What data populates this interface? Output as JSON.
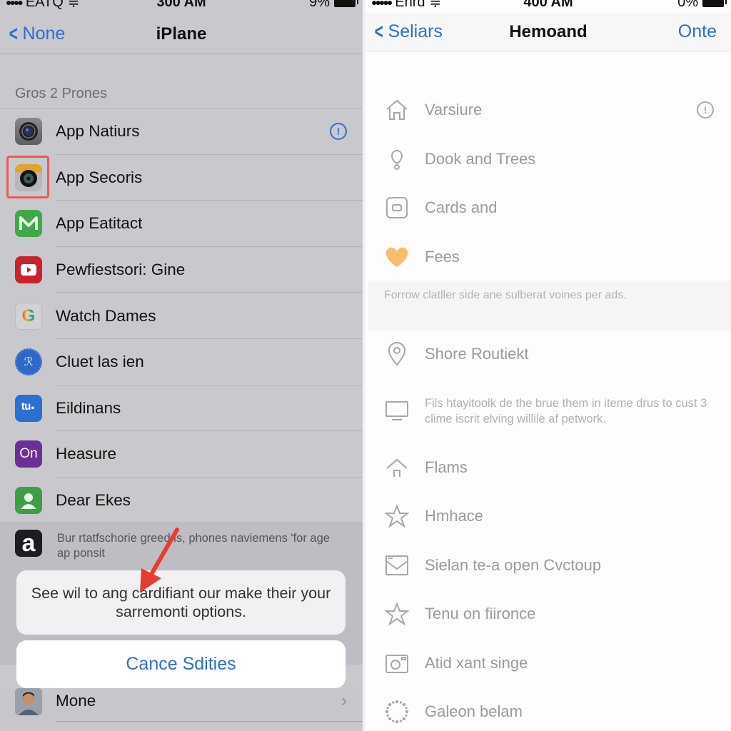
{
  "left_screen": {
    "status_bar": {
      "carrier": "EATQ",
      "time": "300 AM",
      "battery": "9%"
    },
    "nav": {
      "back_label": "None",
      "title": "iPlane"
    },
    "section_header": "Gros 2 Prones",
    "items": [
      {
        "label": "App Natiurs",
        "icon": "camera-lens-icon",
        "has_info": true
      },
      {
        "label": "App Secoris",
        "icon": "security-camera-icon",
        "highlighted": true
      },
      {
        "label": "App Eatitact",
        "icon": "mail-m-icon"
      },
      {
        "label": "Pewfiestsori: Gine",
        "icon": "youtube-play-icon"
      },
      {
        "label": "Watch Dames",
        "icon": "google-g-icon"
      },
      {
        "label": "Cluet las ien",
        "icon": "leaf-badge-icon"
      },
      {
        "label": "Eildinans",
        "icon": "tu-logo-icon"
      },
      {
        "label": "Heasure",
        "icon": "on-logo-icon",
        "icon_text": "On"
      },
      {
        "label": "Dear Ekes",
        "icon": "contact-person-icon"
      }
    ],
    "footer": {
      "icon_text": "a",
      "text": "Bur rtatfschorie greed is, phones naviemens 'for age ap ponsit"
    },
    "action_sheet": {
      "message": "See wil to ang cardifiant our make their your sarremonti options.",
      "cancel_label": "Cance Sdities"
    },
    "bottom_item": {
      "label": "Mone"
    }
  },
  "right_screen": {
    "status_bar": {
      "carrier": "Enrd",
      "time": "400 AM",
      "battery": "0%"
    },
    "nav": {
      "back_label": "Seliars",
      "title": "Hemoand",
      "right_label": "Onte"
    },
    "section1": [
      {
        "label": "Varsiure",
        "icon": "home-icon",
        "has_info": true
      },
      {
        "label": "Dook and Trees",
        "icon": "lightbulb-icon"
      },
      {
        "label": "Cards and",
        "icon": "card-icon"
      },
      {
        "label": "Fees",
        "icon": "heart-icon"
      }
    ],
    "section1_footer": "Forrow clatller side ane sulberat voines per ads.",
    "section2": [
      {
        "label": "Shore Routiekt",
        "icon": "location-pin-icon"
      },
      {
        "description": "Fils htayitoolk de the brue them in iteme drus to cust 3 clime iscrit elving willile af petwork.",
        "icon": "monitor-icon"
      },
      {
        "label": "Flams",
        "icon": "upload-house-icon"
      },
      {
        "label": "Hmhace",
        "icon": "star-icon"
      },
      {
        "label": "Sielan te-a open Cvctoup",
        "icon": "envelope-icon"
      },
      {
        "label": "Tenu on fiironce",
        "icon": "star-icon"
      },
      {
        "label": "Atid xant singe",
        "icon": "camera-icon"
      },
      {
        "label": "Galeon belam",
        "icon": "loading-spinner-icon"
      }
    ]
  },
  "colors": {
    "accent_blue": "#2e6fd0",
    "highlight_red": "#e85b5b",
    "heart_orange": "#f6bd6d"
  }
}
